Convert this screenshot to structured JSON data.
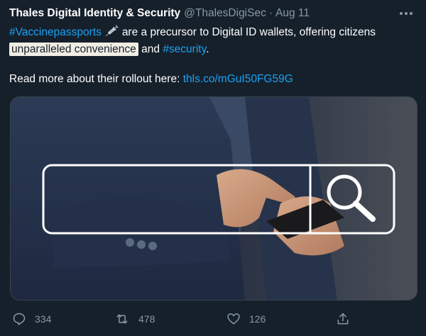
{
  "tweet": {
    "author_name": "Thales Digital Identity & Security",
    "handle": "@ThalesDigiSec",
    "separator": "·",
    "date": "Aug 11",
    "more_icon": "more-dots-icon",
    "text": {
      "hashtag1": "#Vaccinepassports",
      "emoji_icon": "syringe-icon",
      "part1": "are a precursor to Digital ID wallets, offering citizens",
      "highlighted": "unparalleled convenience",
      "part2": "and",
      "hashtag2": "#security",
      "part3": ".",
      "readmore": "Read more about their rollout here:",
      "url": "thls.co/mGuI50FG59G"
    },
    "media": {
      "description_icon": "search-bar-icon"
    },
    "actions": {
      "replies": "334",
      "retweets": "478",
      "likes": "126",
      "reply_icon": "reply-icon",
      "retweet_icon": "retweet-icon",
      "like_icon": "heart-icon",
      "share_icon": "share-icon"
    }
  },
  "colors": {
    "background": "#15202b",
    "link": "#1da1f2",
    "secondary": "#8899a6",
    "highlight_bg": "#f1ede4"
  }
}
